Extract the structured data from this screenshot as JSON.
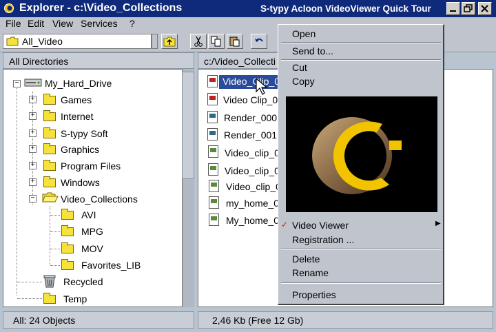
{
  "window": {
    "title": "Explorer - c:\\Video_Collections",
    "right_title": "S-typy Acloon VideoViewer Quick Tour",
    "minimize_icon": "minimize-icon",
    "restore_icon": "restore-icon",
    "close_icon": "close-icon"
  },
  "menu": [
    "File",
    "Edit",
    "View",
    "Services",
    "?"
  ],
  "toolbar": {
    "address_value": "All_Video",
    "buttons": [
      "up-folder-icon",
      "cut-icon",
      "copy-icon",
      "paste-icon",
      "undo-icon"
    ]
  },
  "left_pane": {
    "header": "All Directories",
    "tree": [
      {
        "label": "My_Hard_Drive",
        "icon": "hard-drive-icon",
        "expanded": true
      },
      {
        "label": "Games",
        "icon": "folder-icon"
      },
      {
        "label": "Internet",
        "icon": "folder-icon"
      },
      {
        "label": "S-typy Soft",
        "icon": "folder-icon"
      },
      {
        "label": "Graphics",
        "icon": "folder-icon"
      },
      {
        "label": "Program Files",
        "icon": "folder-icon"
      },
      {
        "label": "Windows",
        "icon": "folder-icon"
      },
      {
        "label": "Video_Collections",
        "icon": "open-folder-icon",
        "expanded": true
      },
      {
        "label": "AVI",
        "icon": "folder-icon"
      },
      {
        "label": "MPG",
        "icon": "folder-icon"
      },
      {
        "label": "MOV",
        "icon": "folder-icon"
      },
      {
        "label": "Favorites_LIB",
        "icon": "folder-icon"
      },
      {
        "label": "Recycled",
        "icon": "recycle-bin-icon"
      },
      {
        "label": "Temp",
        "icon": "folder-icon"
      }
    ]
  },
  "right_pane": {
    "header": "c:/Video_Collecti",
    "files": [
      {
        "label": "Video_Clip_0",
        "selected": true
      },
      {
        "label": "Video Clip_0"
      },
      {
        "label": "Render_000"
      },
      {
        "label": "Render_001"
      },
      {
        "label": "Video_clip_0"
      },
      {
        "label": "Video_clip_0"
      },
      {
        "label": "Video_clip_0"
      },
      {
        "label": "my_home_0"
      },
      {
        "label": "My_home_0"
      }
    ]
  },
  "status": {
    "left": "All: 24 Objects",
    "right": "2,46 Kb (Free 12 Gb)"
  },
  "context_menu": {
    "open": "Open",
    "send_to": "Send to...",
    "cut": "Cut",
    "copy": "Copy",
    "video_viewer": "Video Viewer",
    "registration": "Registration ...",
    "delete": "Delete",
    "rename": "Rename",
    "properties": "Properties"
  },
  "colors": {
    "title_bar": "#0f2a7a",
    "logo_yellow": "#f2c400",
    "logo_bronze": "#9a7a52",
    "selection": "#2a4a9a"
  }
}
